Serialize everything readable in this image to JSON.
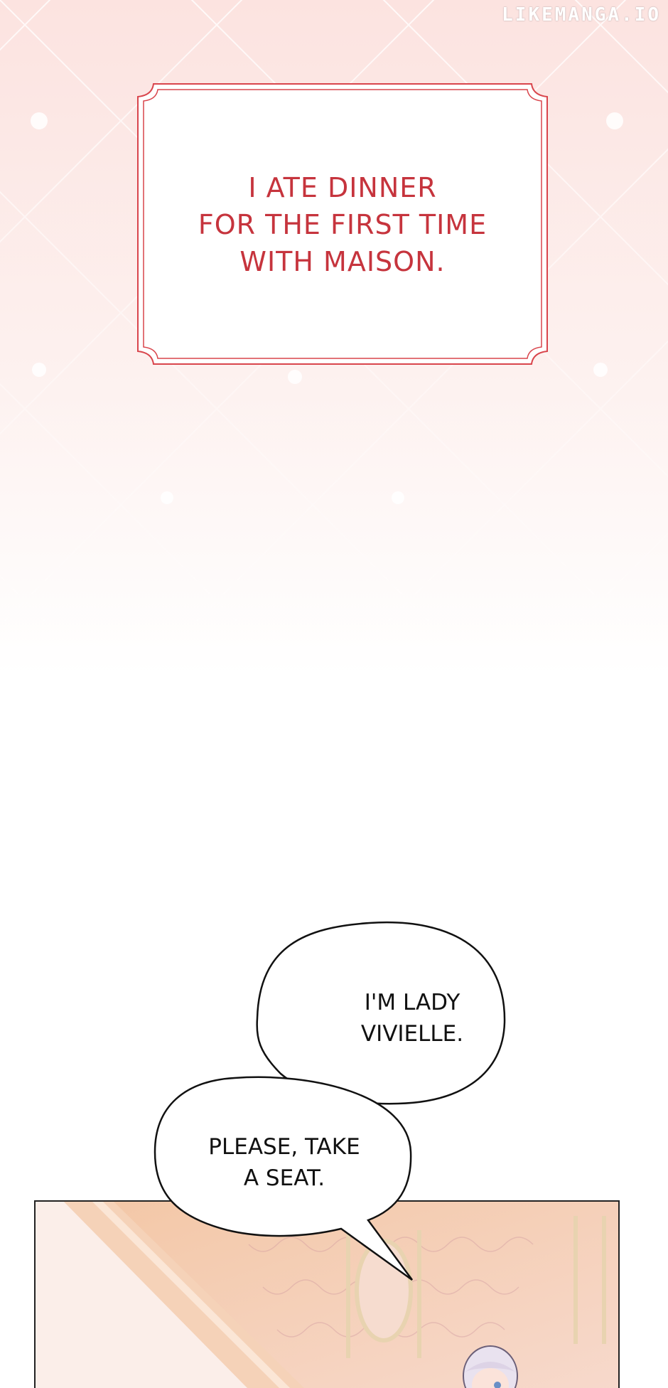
{
  "watermark": "LIKEMANGA.IO",
  "narration": {
    "lines": [
      "I ATE DINNER",
      "FOR THE FIRST TIME",
      "WITH MAISON."
    ]
  },
  "speech_bubbles": [
    {
      "lines": [
        "I'M LADY",
        "VIVIELLE."
      ]
    },
    {
      "lines": [
        "PLEASE, TAKE",
        "A SEAT."
      ]
    }
  ],
  "colors": {
    "narration_text": "#c6343d",
    "frame": "#d9454c",
    "background_pink": "#fde9e7"
  }
}
